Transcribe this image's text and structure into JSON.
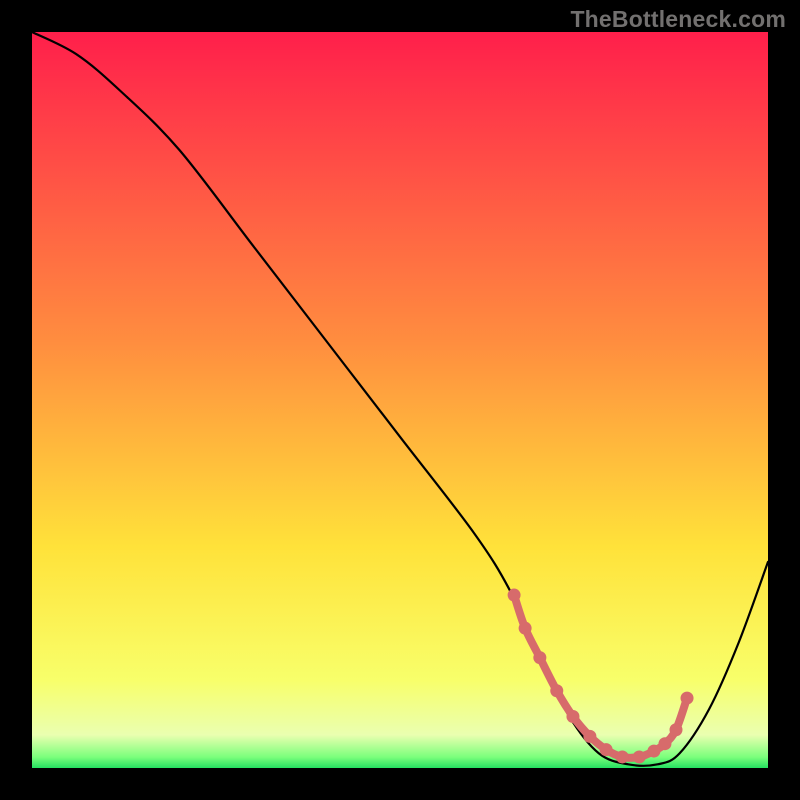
{
  "watermark": "TheBottleneck.com",
  "chart_data": {
    "type": "line",
    "title": "",
    "xlabel": "",
    "ylabel": "",
    "xlim": [
      0,
      100
    ],
    "ylim": [
      0,
      100
    ],
    "curve": {
      "name": "bottleneck-curve",
      "x": [
        0,
        6,
        12,
        20,
        30,
        40,
        50,
        60,
        65,
        69,
        73,
        77,
        81,
        85,
        88,
        92,
        96,
        100
      ],
      "y": [
        100,
        97,
        92,
        84,
        71,
        58,
        45,
        32,
        24,
        15,
        7,
        2,
        0.5,
        0.5,
        2,
        8,
        17,
        28
      ]
    },
    "optimal_segment": {
      "name": "optimal-range",
      "color": "#d76b6b",
      "x": [
        65.5,
        67,
        69,
        71.3,
        73.5,
        75.8,
        78,
        80.2,
        82.5,
        84.5,
        86,
        87.5,
        89
      ],
      "y": [
        23.5,
        19,
        15,
        10.5,
        7,
        4.3,
        2.5,
        1.5,
        1.5,
        2.3,
        3.3,
        5.2,
        9.5
      ]
    },
    "gradient_stops": [
      {
        "offset": 0,
        "color": "#ff1f4b"
      },
      {
        "offset": 0.42,
        "color": "#ff8d3f"
      },
      {
        "offset": 0.7,
        "color": "#ffe23a"
      },
      {
        "offset": 0.88,
        "color": "#f8ff6a"
      },
      {
        "offset": 0.955,
        "color": "#eaffb0"
      },
      {
        "offset": 0.985,
        "color": "#7cff7c"
      },
      {
        "offset": 1.0,
        "color": "#25e061"
      }
    ]
  }
}
